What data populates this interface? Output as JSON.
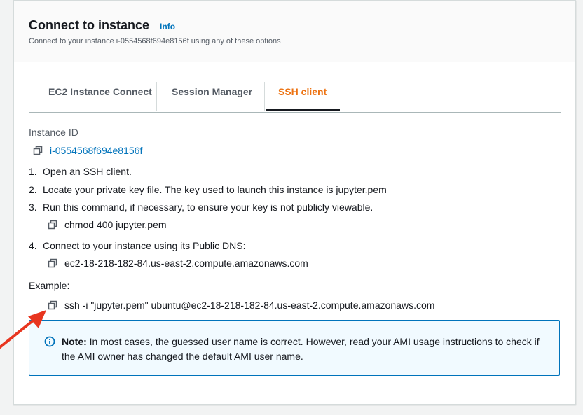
{
  "header": {
    "title": "Connect to instance",
    "info_label": "Info",
    "subtitle": "Connect to your instance i-0554568f694e8156f using any of these options"
  },
  "tabs": [
    {
      "label": "EC2 Instance Connect"
    },
    {
      "label": "Session Manager"
    },
    {
      "label": "SSH client"
    }
  ],
  "instance": {
    "label": "Instance ID",
    "id": "i-0554568f694e8156f"
  },
  "steps": [
    {
      "num": "1.",
      "text": "Open an SSH client."
    },
    {
      "num": "2.",
      "text": "Locate your private key file. The key used to launch this instance is jupyter.pem"
    },
    {
      "num": "3.",
      "text": "Run this command, if necessary, to ensure your key is not publicly viewable."
    },
    {
      "num": "4.",
      "text": "Connect to your instance using its Public DNS:"
    }
  ],
  "commands": {
    "chmod": "chmod 400 jupyter.pem",
    "dns": "ec2-18-218-182-84.us-east-2.compute.amazonaws.com"
  },
  "example": {
    "label": "Example:",
    "command": "ssh -i \"jupyter.pem\" ubuntu@ec2-18-218-182-84.us-east-2.compute.amazonaws.com"
  },
  "note": {
    "bold": "Note:",
    "text": " In most cases, the guessed user name is correct. However, read your AMI usage instructions to check if the AMI owner has changed the default AMI user name."
  },
  "colors": {
    "accent": "#ec7211",
    "link": "#0073bb",
    "annotation_arrow": "#e8351f"
  },
  "icons": [
    "copy-icon",
    "info-circle-icon",
    "annotation-arrow"
  ]
}
